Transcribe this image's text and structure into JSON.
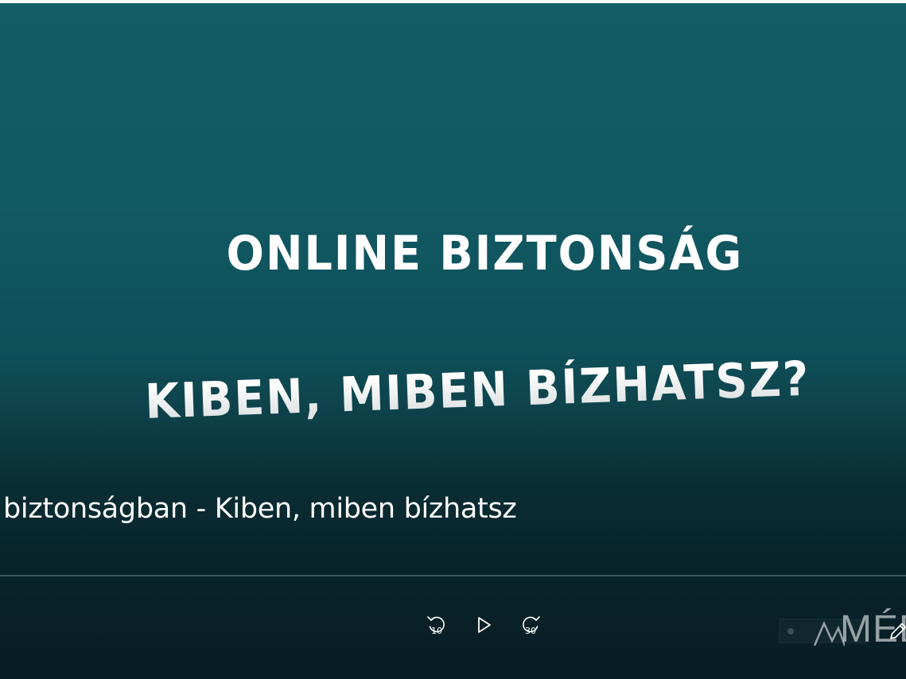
{
  "slide": {
    "line1": "ONLINE BIZTONSÁG",
    "line2": "KIBEN, MIBEN BÍZHATSZ?"
  },
  "video": {
    "title": "biztonságban - Kiben, miben bízhatsz"
  },
  "controls": {
    "rewind_icon": "rewind-10-icon",
    "rewind_seconds": "10",
    "play_icon": "play-icon",
    "forward_icon": "forward-30-icon",
    "forward_seconds": "30"
  },
  "watermark": {
    "logo_text": "MÉD"
  },
  "edit": {
    "icon": "pencil-icon"
  },
  "colors": {
    "background_top": "#125d66",
    "background_bottom": "#071d23",
    "text": "#ffffff"
  }
}
